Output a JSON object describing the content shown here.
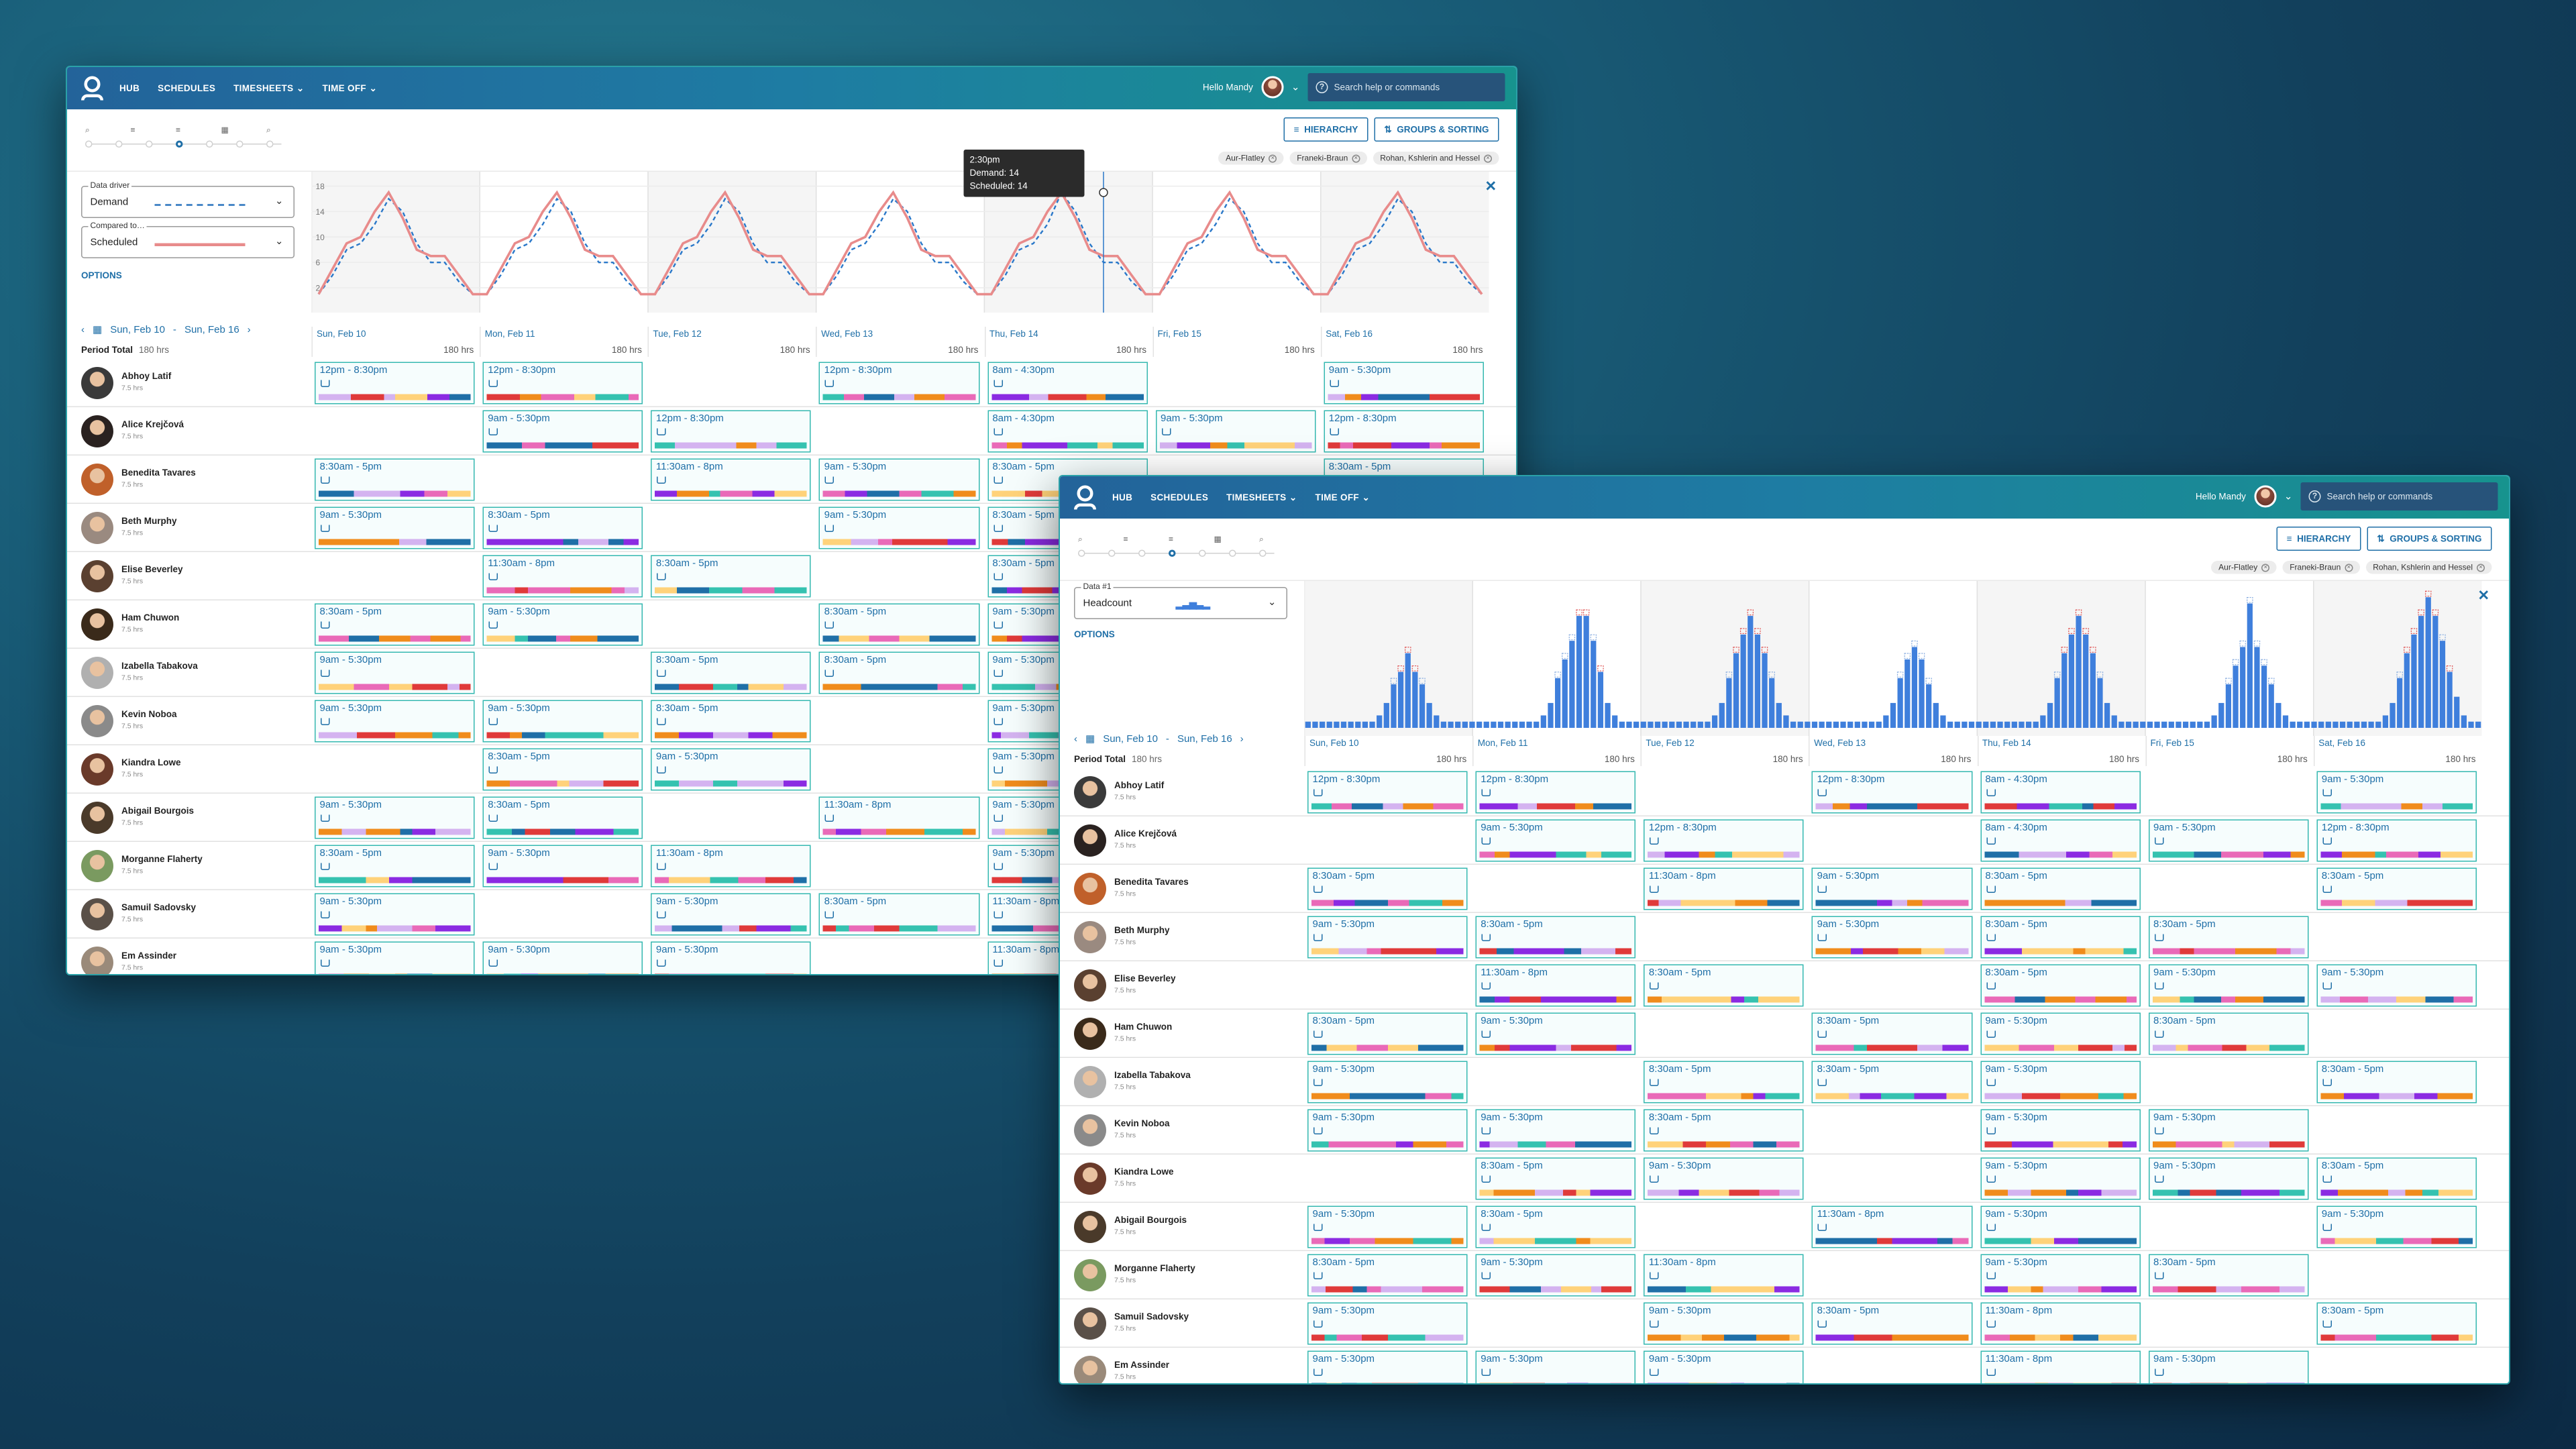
{
  "nav": {
    "hub": "HUB",
    "schedules": "SCHEDULES",
    "timesheets": "TIMESHEETS",
    "time_off": "TIME OFF",
    "hello": "Hello Mandy",
    "search_placeholder": "Search help or commands"
  },
  "toolbar": {
    "hierarchy": "HIERARCHY",
    "groups": "GROUPS & SORTING"
  },
  "filters": [
    "Aur-Flatley",
    "Franeki-Braun",
    "Rohan, Kshlerin and Hessel"
  ],
  "panel1": {
    "driver_label": "Data driver",
    "driver_value": "Demand",
    "compare_label": "Compared to…",
    "compare_value": "Scheduled",
    "options": "OPTIONS"
  },
  "panel2": {
    "data_label": "Data #1",
    "data_value": "Headcount",
    "options": "OPTIONS"
  },
  "range": {
    "start": "Sun, Feb 10",
    "sep": "-",
    "end": "Sun, Feb 16"
  },
  "period": {
    "label": "Period Total",
    "hours": "180 hrs"
  },
  "tooltip": {
    "time": "2:30pm",
    "demand": "Demand: 14",
    "scheduled": "Scheduled: 14"
  },
  "days": [
    {
      "name": "Sun, Feb 10",
      "hours": "180 hrs"
    },
    {
      "name": "Mon, Feb 11",
      "hours": "180 hrs"
    },
    {
      "name": "Tue, Feb 12",
      "hours": "180 hrs"
    },
    {
      "name": "Wed, Feb 13",
      "hours": "180 hrs"
    },
    {
      "name": "Thu, Feb 14",
      "hours": "180 hrs"
    },
    {
      "name": "Fri, Feb 15",
      "hours": "180 hrs"
    },
    {
      "name": "Sat, Feb 16",
      "hours": "180 hrs"
    }
  ],
  "employees": [
    {
      "name": "Abhoy Latif",
      "hours": "7.5 hrs",
      "color": "#3a3a3a",
      "shifts": [
        "12pm - 8:30pm",
        "12pm - 8:30pm",
        "",
        "12pm - 8:30pm",
        "8am - 4:30pm",
        "",
        "9am - 5:30pm"
      ]
    },
    {
      "name": "Alice Krejčová",
      "hours": "7.5 hrs",
      "color": "#2a2220",
      "shifts": [
        "",
        "9am - 5:30pm",
        "12pm - 8:30pm",
        "",
        "8am - 4:30pm",
        "9am - 5:30pm",
        "12pm - 8:30pm"
      ]
    },
    {
      "name": "Benedita Tavares",
      "hours": "7.5 hrs",
      "color": "#c0602a",
      "shifts": [
        "8:30am - 5pm",
        "",
        "11:30am - 8pm",
        "9am - 5:30pm",
        "8:30am - 5pm",
        "",
        "8:30am - 5pm"
      ]
    },
    {
      "name": "Beth Murphy",
      "hours": "7.5 hrs",
      "color": "#9a8a80",
      "shifts": [
        "9am - 5:30pm",
        "8:30am - 5pm",
        "",
        "9am - 5:30pm",
        "8:30am - 5pm",
        "8:30am - 5pm",
        ""
      ]
    },
    {
      "name": "Elise Beverley",
      "hours": "7.5 hrs",
      "color": "#5a4030",
      "shifts": [
        "",
        "11:30am - 8pm",
        "8:30am - 5pm",
        "",
        "8:30am - 5pm",
        "9am - 5:30pm",
        "9am - 5:30pm"
      ]
    },
    {
      "name": "Ham Chuwon",
      "hours": "7.5 hrs",
      "color": "#3a2a1a",
      "shifts": [
        "8:30am - 5pm",
        "9am - 5:30pm",
        "",
        "8:30am - 5pm",
        "9am - 5:30pm",
        "8:30am - 5pm",
        ""
      ]
    },
    {
      "name": "Izabella Tabakova",
      "hours": "7.5 hrs",
      "color": "#b0b0b0",
      "shifts": [
        "9am - 5:30pm",
        "",
        "8:30am - 5pm",
        "8:30am - 5pm",
        "9am - 5:30pm",
        "",
        "8:30am - 5pm"
      ]
    },
    {
      "name": "Kevin Noboa",
      "hours": "7.5 hrs",
      "color": "#8a8a8a",
      "shifts": [
        "9am - 5:30pm",
        "9am - 5:30pm",
        "8:30am - 5pm",
        "",
        "9am - 5:30pm",
        "9am - 5:30pm",
        ""
      ]
    },
    {
      "name": "Kiandra Lowe",
      "hours": "7.5 hrs",
      "color": "#6a3a2a",
      "shifts": [
        "",
        "8:30am - 5pm",
        "9am - 5:30pm",
        "",
        "9am - 5:30pm",
        "9am - 5:30pm",
        "8:30am - 5pm"
      ]
    },
    {
      "name": "Abigail Bourgois",
      "hours": "7.5 hrs",
      "color": "#4a3a2a",
      "shifts": [
        "9am - 5:30pm",
        "8:30am - 5pm",
        "",
        "11:30am - 8pm",
        "9am - 5:30pm",
        "",
        "9am - 5:30pm"
      ]
    },
    {
      "name": "Morganne Flaherty",
      "hours": "7.5 hrs",
      "color": "#7a9a60",
      "shifts": [
        "8:30am - 5pm",
        "9am - 5:30pm",
        "11:30am - 8pm",
        "",
        "9am - 5:30pm",
        "8:30am - 5pm",
        ""
      ]
    },
    {
      "name": "Samuil Sadovsky",
      "hours": "7.5 hrs",
      "color": "#5a5048",
      "shifts": [
        "9am - 5:30pm",
        "",
        "9am - 5:30pm",
        "8:30am - 5pm",
        "11:30am - 8pm",
        "",
        "8:30am - 5pm"
      ]
    },
    {
      "name": "Em Assinder",
      "hours": "7.5 hrs",
      "color": "#9a8a7a",
      "shifts": [
        "9am - 5:30pm",
        "9am - 5:30pm",
        "9am - 5:30pm",
        "",
        "11:30am - 8pm",
        "9am - 5:30pm",
        ""
      ]
    }
  ],
  "task_colors": [
    "#8b2be2",
    "#35c2b0",
    "#f08c1c",
    "#1f6fa7",
    "#e03a3a",
    "#d4b3f0",
    "#ffd27a",
    "#e96ab8"
  ],
  "chart_data": [
    {
      "type": "line",
      "series": [
        {
          "name": "Demand",
          "style": "dashed",
          "color": "#2a78c9",
          "values": [
            1,
            4,
            8,
            9,
            12,
            16,
            14,
            9,
            6,
            6,
            3,
            1,
            1,
            4,
            8,
            9,
            12,
            16,
            14,
            9,
            6,
            6,
            3,
            1,
            1,
            4,
            8,
            9,
            12,
            16,
            14,
            9,
            6,
            6,
            3,
            1,
            1,
            4,
            8,
            9,
            12,
            16,
            14,
            9,
            6,
            6,
            3,
            1,
            1,
            4,
            8,
            9,
            12,
            17,
            14,
            9,
            6,
            6,
            3,
            1,
            1,
            4,
            8,
            9,
            12,
            16,
            14,
            9,
            6,
            6,
            3,
            1,
            1,
            4,
            8,
            9,
            12,
            16,
            14,
            9,
            6,
            6,
            3,
            1
          ]
        },
        {
          "name": "Scheduled",
          "style": "solid",
          "color": "#e88b8b",
          "values": [
            1,
            5,
            9,
            10,
            14,
            17,
            13,
            8,
            7,
            7,
            4,
            1,
            1,
            5,
            9,
            10,
            14,
            17,
            13,
            8,
            7,
            7,
            4,
            1,
            1,
            5,
            9,
            10,
            14,
            17,
            13,
            8,
            7,
            7,
            4,
            1,
            1,
            5,
            9,
            10,
            14,
            17,
            13,
            8,
            7,
            7,
            4,
            1,
            1,
            5,
            9,
            10,
            14,
            17,
            13,
            8,
            7,
            7,
            4,
            1,
            1,
            5,
            9,
            10,
            14,
            17,
            13,
            8,
            7,
            7,
            4,
            1,
            1,
            5,
            9,
            10,
            14,
            17,
            13,
            8,
            7,
            7,
            4,
            1
          ]
        }
      ],
      "yticks": [
        2,
        6,
        10,
        14,
        18
      ],
      "ylim": [
        0,
        19
      ]
    },
    {
      "type": "bar",
      "name": "Headcount",
      "color": "#3f7fdc",
      "values": [
        1,
        1,
        1,
        1,
        1,
        1,
        1,
        1,
        1,
        1,
        2,
        4,
        7,
        9,
        12,
        9,
        7,
        4,
        2,
        1,
        1,
        1,
        1,
        1,
        1,
        1,
        1,
        1,
        1,
        1,
        1,
        1,
        1,
        2,
        4,
        8,
        11,
        14,
        18,
        18,
        14,
        9,
        4,
        2,
        1,
        1,
        1,
        1,
        1,
        1,
        1,
        1,
        1,
        1,
        1,
        1,
        1,
        2,
        4,
        8,
        12,
        15,
        18,
        15,
        12,
        8,
        4,
        2,
        1,
        1,
        1,
        1,
        1,
        1,
        1,
        1,
        1,
        1,
        1,
        1,
        1,
        2,
        4,
        8,
        11,
        13,
        11,
        7,
        4,
        2,
        1,
        1,
        1,
        1,
        1,
        1,
        1,
        1,
        1,
        1,
        1,
        1,
        1,
        2,
        4,
        8,
        12,
        15,
        18,
        15,
        12,
        8,
        4,
        2,
        1,
        1,
        1,
        1,
        1,
        1,
        1,
        1,
        1,
        1,
        1,
        1,
        1,
        2,
        4,
        7,
        10,
        13,
        20,
        13,
        10,
        7,
        4,
        2,
        1,
        1,
        1,
        1,
        1,
        1,
        1,
        1,
        1,
        1,
        1,
        1,
        1,
        2,
        4,
        8,
        12,
        15,
        18,
        21,
        18,
        14,
        9,
        5,
        2,
        1,
        1
      ]
    }
  ]
}
